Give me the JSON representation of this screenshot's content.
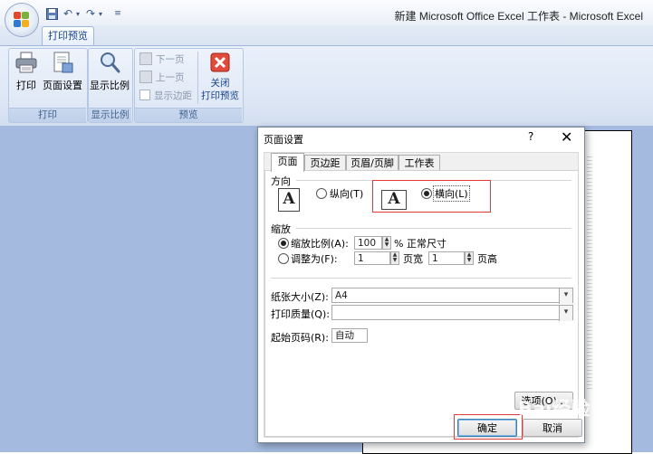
{
  "window": {
    "title": "新建 Microsoft Office Excel 工作表 - Microsoft Excel"
  },
  "ribbon": {
    "active_tab": "打印预览",
    "groups": {
      "print": {
        "label": "打印",
        "print_button": "打印",
        "page_setup_button": "页面设置"
      },
      "zoom": {
        "label": "显示比例",
        "zoom_button": "显示比例"
      },
      "preview": {
        "label": "预览",
        "next_page": "下一页",
        "prev_page": "上一页",
        "show_margins": "显示边距",
        "close_preview_line1": "关闭",
        "close_preview_line2": "打印预览"
      }
    }
  },
  "dialog": {
    "title": "页面设置",
    "help_glyph": "?",
    "close_glyph": "✕",
    "tabs": [
      "页面",
      "页边距",
      "页眉/页脚",
      "工作表"
    ],
    "active_tab_index": 0,
    "orientation": {
      "section_label": "方向",
      "portrait_label": "纵向(T)",
      "landscape_label": "横向(L)",
      "selected": "landscape",
      "icon_glyph": "A"
    },
    "scaling": {
      "section_label": "缩放",
      "adjust_to_label": "缩放比例(A):",
      "adjust_to_value": "100",
      "adjust_to_unit": "% 正常尺寸",
      "fit_to_label": "调整为(F):",
      "fit_pages_wide_value": "1",
      "fit_pages_wide_unit": "页宽",
      "fit_pages_tall_value": "1",
      "fit_pages_tall_unit": "页高",
      "selected": "adjust_to"
    },
    "paper_size": {
      "label": "纸张大小(Z):",
      "value": "A4"
    },
    "print_quality": {
      "label": "打印质量(Q):",
      "value": ""
    },
    "first_page_number": {
      "label": "起始页码(R):",
      "value": "自动"
    },
    "options_button": "选项(O)...",
    "ok_button": "确定",
    "cancel_button": "取消"
  },
  "watermark": {
    "text": "Bai经验"
  },
  "colors": {
    "highlight": "#e23a3a",
    "workspace": "#a4bbdf",
    "ribbon_text": "#15428b"
  }
}
